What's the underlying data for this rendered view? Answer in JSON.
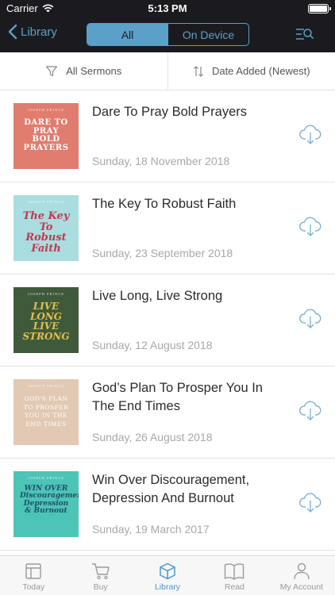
{
  "status": {
    "carrier": "Carrier",
    "time": "5:13 PM"
  },
  "nav": {
    "back_label": "Library",
    "segments": [
      "All",
      "On Device"
    ],
    "active_segment": 0
  },
  "filters": {
    "category": "All Sermons",
    "sort": "Date Added (Newest)"
  },
  "sermons": [
    {
      "title": "Dare To Pray Bold Prayers",
      "date": "Sunday, 18 November 2018",
      "art_text": "DARE TO PRAY BOLD PRAYERS",
      "art_publisher": "JOSEPH PRINCE",
      "art_bg": "#e07d6e"
    },
    {
      "title": "The Key To Robust Faith",
      "date": "Sunday, 23 September 2018",
      "art_text": "The Key To Robust Faith",
      "art_publisher": "JOSEPH PRINCE",
      "art_bg": "#a9dde0"
    },
    {
      "title": "Live Long, Live Strong",
      "date": "Sunday, 12 August 2018",
      "art_text": "LIVE LONG LIVE STRONG",
      "art_publisher": "JOSEPH PRINCE",
      "art_bg": "#3f5a3a"
    },
    {
      "title": "God’s Plan To Prosper You In The End Times",
      "date": "Sunday, 26 August 2018",
      "art_text": "GOD'S PLAN TO PROSPER YOU IN THE END TIMES",
      "art_publisher": "JOSEPH PRINCE",
      "art_bg": "#e2c9b3"
    },
    {
      "title": "Win Over Discouragement, Depression And Burnout",
      "date": "Sunday, 19 March 2017",
      "art_text": "WIN OVER Discouragement Depression & Burnout",
      "art_publisher": "JOSEPH PRINCE",
      "art_bg": "#4cc4b6"
    }
  ],
  "tabs": [
    {
      "label": "Today",
      "icon": "today-icon"
    },
    {
      "label": "Buy",
      "icon": "cart-icon"
    },
    {
      "label": "Library",
      "icon": "library-box-icon"
    },
    {
      "label": "Read",
      "icon": "book-icon"
    },
    {
      "label": "My Account",
      "icon": "person-icon"
    }
  ],
  "active_tab": 2,
  "colors": {
    "accent": "#5aa0c8",
    "nav_bg": "#1b1b1f"
  }
}
